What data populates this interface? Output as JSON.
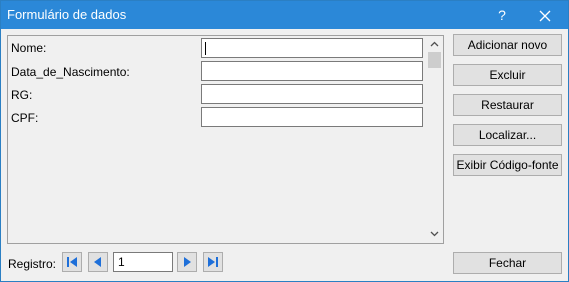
{
  "window": {
    "title": "Formulário de dados",
    "help_label": "?",
    "close_icon": "close-icon"
  },
  "form": {
    "fields": [
      {
        "label": "Nome:",
        "value": ""
      },
      {
        "label": "Data_de_Nascimento:",
        "value": ""
      },
      {
        "label": "RG:",
        "value": ""
      },
      {
        "label": "CPF:",
        "value": ""
      }
    ],
    "scroll_up_icon": "chevron-up-icon",
    "scroll_down_icon": "chevron-down-icon"
  },
  "buttons": {
    "add_new": "Adicionar novo",
    "delete": "Excluir",
    "restore": "Restaurar",
    "find": "Localizar...",
    "view_code": "Exibir Código-fonte",
    "close": "Fechar"
  },
  "navigation": {
    "record_label": "Registro:",
    "record_value": "1",
    "first_icon": "first-record-icon",
    "prev_icon": "previous-record-icon",
    "next_icon": "next-record-icon",
    "last_icon": "last-record-icon"
  },
  "colors": {
    "titlebar": "#2b88d8",
    "nav_arrow": "#1e6fd9"
  }
}
